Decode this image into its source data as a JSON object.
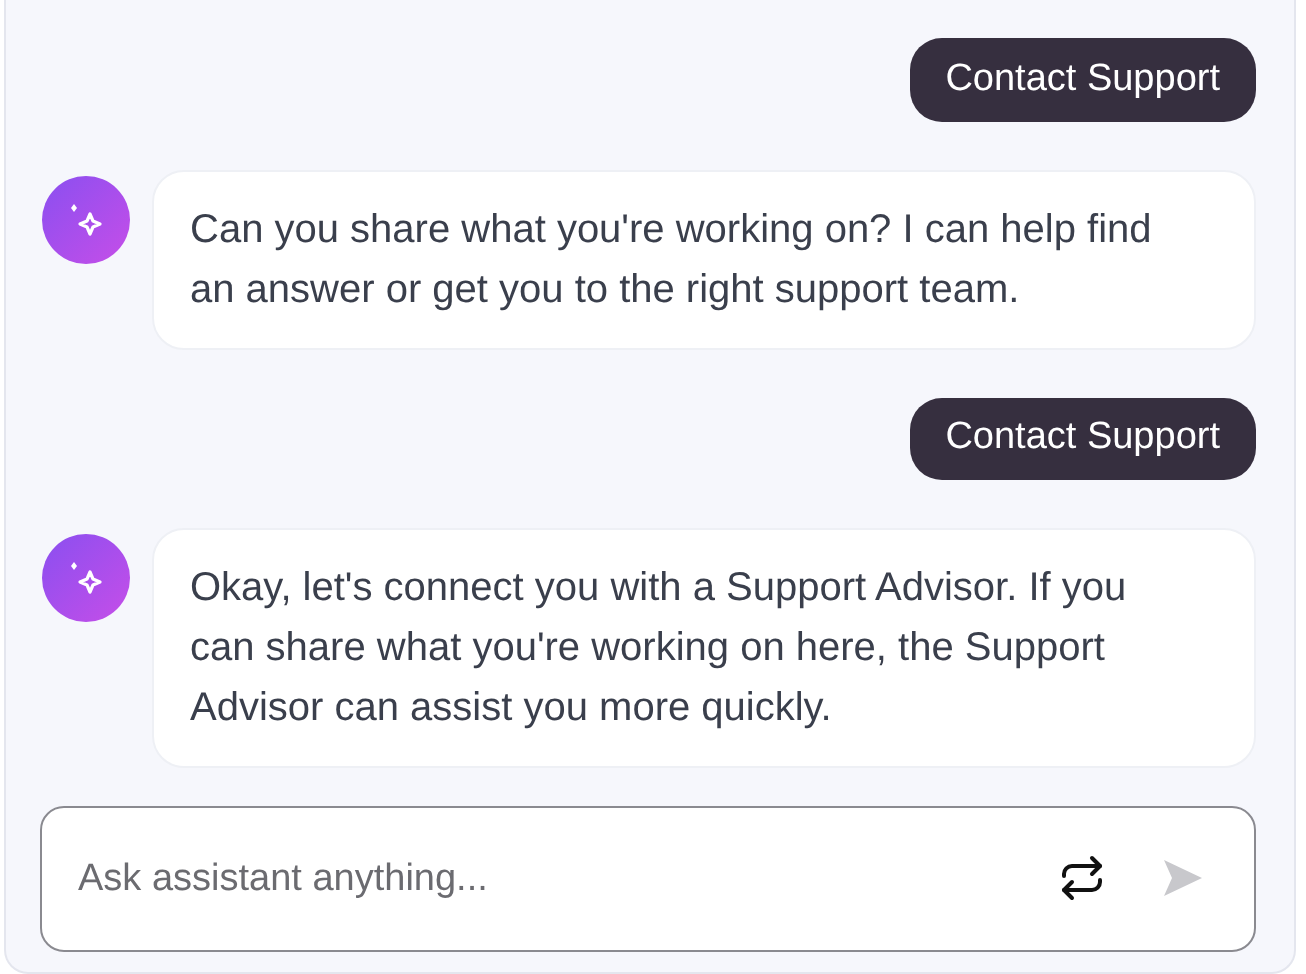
{
  "messages": [
    {
      "kind": "user",
      "text": "Contact Support"
    },
    {
      "kind": "assistant",
      "text": "Can you share what you're working on? I can help find an answer or get you to the right support team."
    },
    {
      "kind": "user",
      "text": "Contact Support"
    },
    {
      "kind": "assistant",
      "text": "Okay, let's connect you with a Support Advisor. If you can share what you're working on here, the Support Advisor can assist you more quickly."
    }
  ],
  "composer": {
    "placeholder": "Ask assistant anything...",
    "send_disabled": true
  }
}
